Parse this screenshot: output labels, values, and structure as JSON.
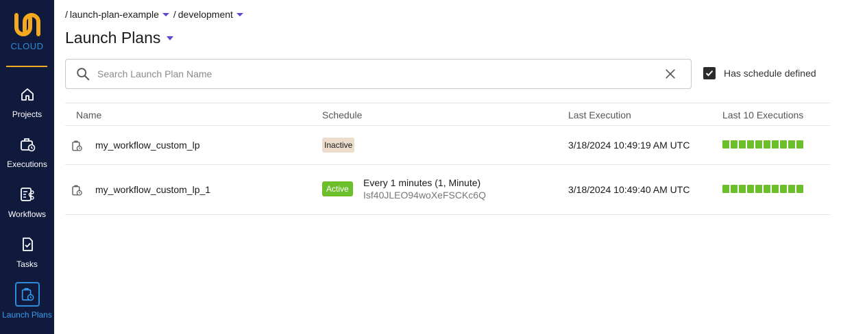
{
  "sidebar": {
    "logo_text": "CLOUD",
    "items": [
      {
        "label": "Projects",
        "icon": "home-icon"
      },
      {
        "label": "Executions",
        "icon": "executions-icon"
      },
      {
        "label": "Workflows",
        "icon": "workflows-icon"
      },
      {
        "label": "Tasks",
        "icon": "tasks-icon"
      },
      {
        "label": "Launch Plans",
        "icon": "launch-plan-icon",
        "active": true
      }
    ]
  },
  "breadcrumb": {
    "project": "launch-plan-example",
    "domain": "development"
  },
  "page": {
    "title": "Launch Plans"
  },
  "search": {
    "placeholder": "Search Launch Plan Name",
    "value": ""
  },
  "filter": {
    "label": "Has schedule defined",
    "checked": true
  },
  "table": {
    "headers": {
      "name": "Name",
      "schedule": "Schedule",
      "last_execution": "Last Execution",
      "last_10": "Last 10 Executions"
    },
    "rows": [
      {
        "name": "my_workflow_custom_lp",
        "status": "Inactive",
        "schedule": "",
        "schedule_id": "",
        "last_execution": "3/18/2024 10:49:19 AM UTC",
        "executions_succeeded": 10
      },
      {
        "name": "my_workflow_custom_lp_1",
        "status": "Active",
        "schedule": "Every 1 minutes (1, Minute)",
        "schedule_id": "Isf40JLEO94woXeFSCKc6Q",
        "last_execution": "3/18/2024 10:49:40 AM UTC",
        "executions_succeeded": 10
      }
    ]
  },
  "colors": {
    "sidebar_bg": "#0f1a3c",
    "accent": "#5a49d6",
    "success": "#6cbe2a",
    "inactive_badge": "#ecdccb",
    "logo_orange": "#f4a91f",
    "logo_blue": "#2f8ad8"
  }
}
